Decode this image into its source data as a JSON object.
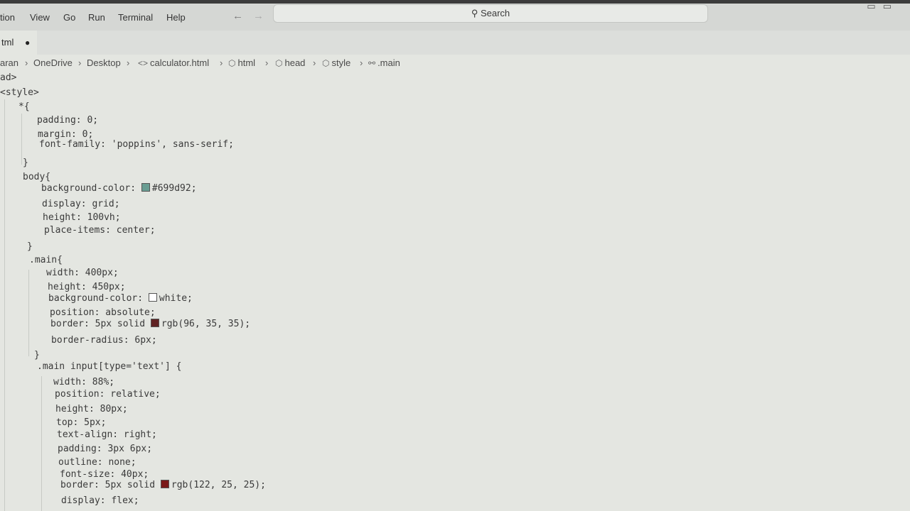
{
  "menu": [
    "tion",
    "View",
    "Go",
    "Run",
    "Terminal",
    "Help"
  ],
  "search": {
    "label": "Search"
  },
  "tab": {
    "label": "tml",
    "dirty_marker": "●"
  },
  "breadcrumb": [
    "aran",
    "OneDrive",
    "Desktop",
    "calculator.html",
    "html",
    "head",
    "style",
    ".main"
  ],
  "code_lines": [
    "ad>",
    "<style>",
    "*{",
    "padding: 0;",
    "margin: 0;",
    "font-family: 'poppins', sans-serif;",
    "}",
    "body{",
    "background-color: #699d92;",
    "display: grid;",
    "height: 100vh;",
    "place-items: center;",
    "}",
    ".main{",
    "width: 400px;",
    "height: 450px;",
    "background-color: white;",
    "position: absolute;",
    "border: 5px solid rgb(96, 35, 35);",
    "border-radius: 6px;",
    "}",
    ".main input[type='text'] {",
    "width: 88%;",
    "position: relative;",
    "height: 80px;",
    "top: 5px;",
    "text-align: right;",
    "padding: 3px 6px;",
    "outline: none;",
    "font-size: 40px;",
    "border: 5px solid rgb(122, 25, 25);",
    "display: flex;"
  ],
  "colors": {
    "swatch_body_bg": "#699d92",
    "swatch_white": "#ffffff",
    "swatch_border_main": "#602323",
    "swatch_border_input": "#7a1919"
  }
}
